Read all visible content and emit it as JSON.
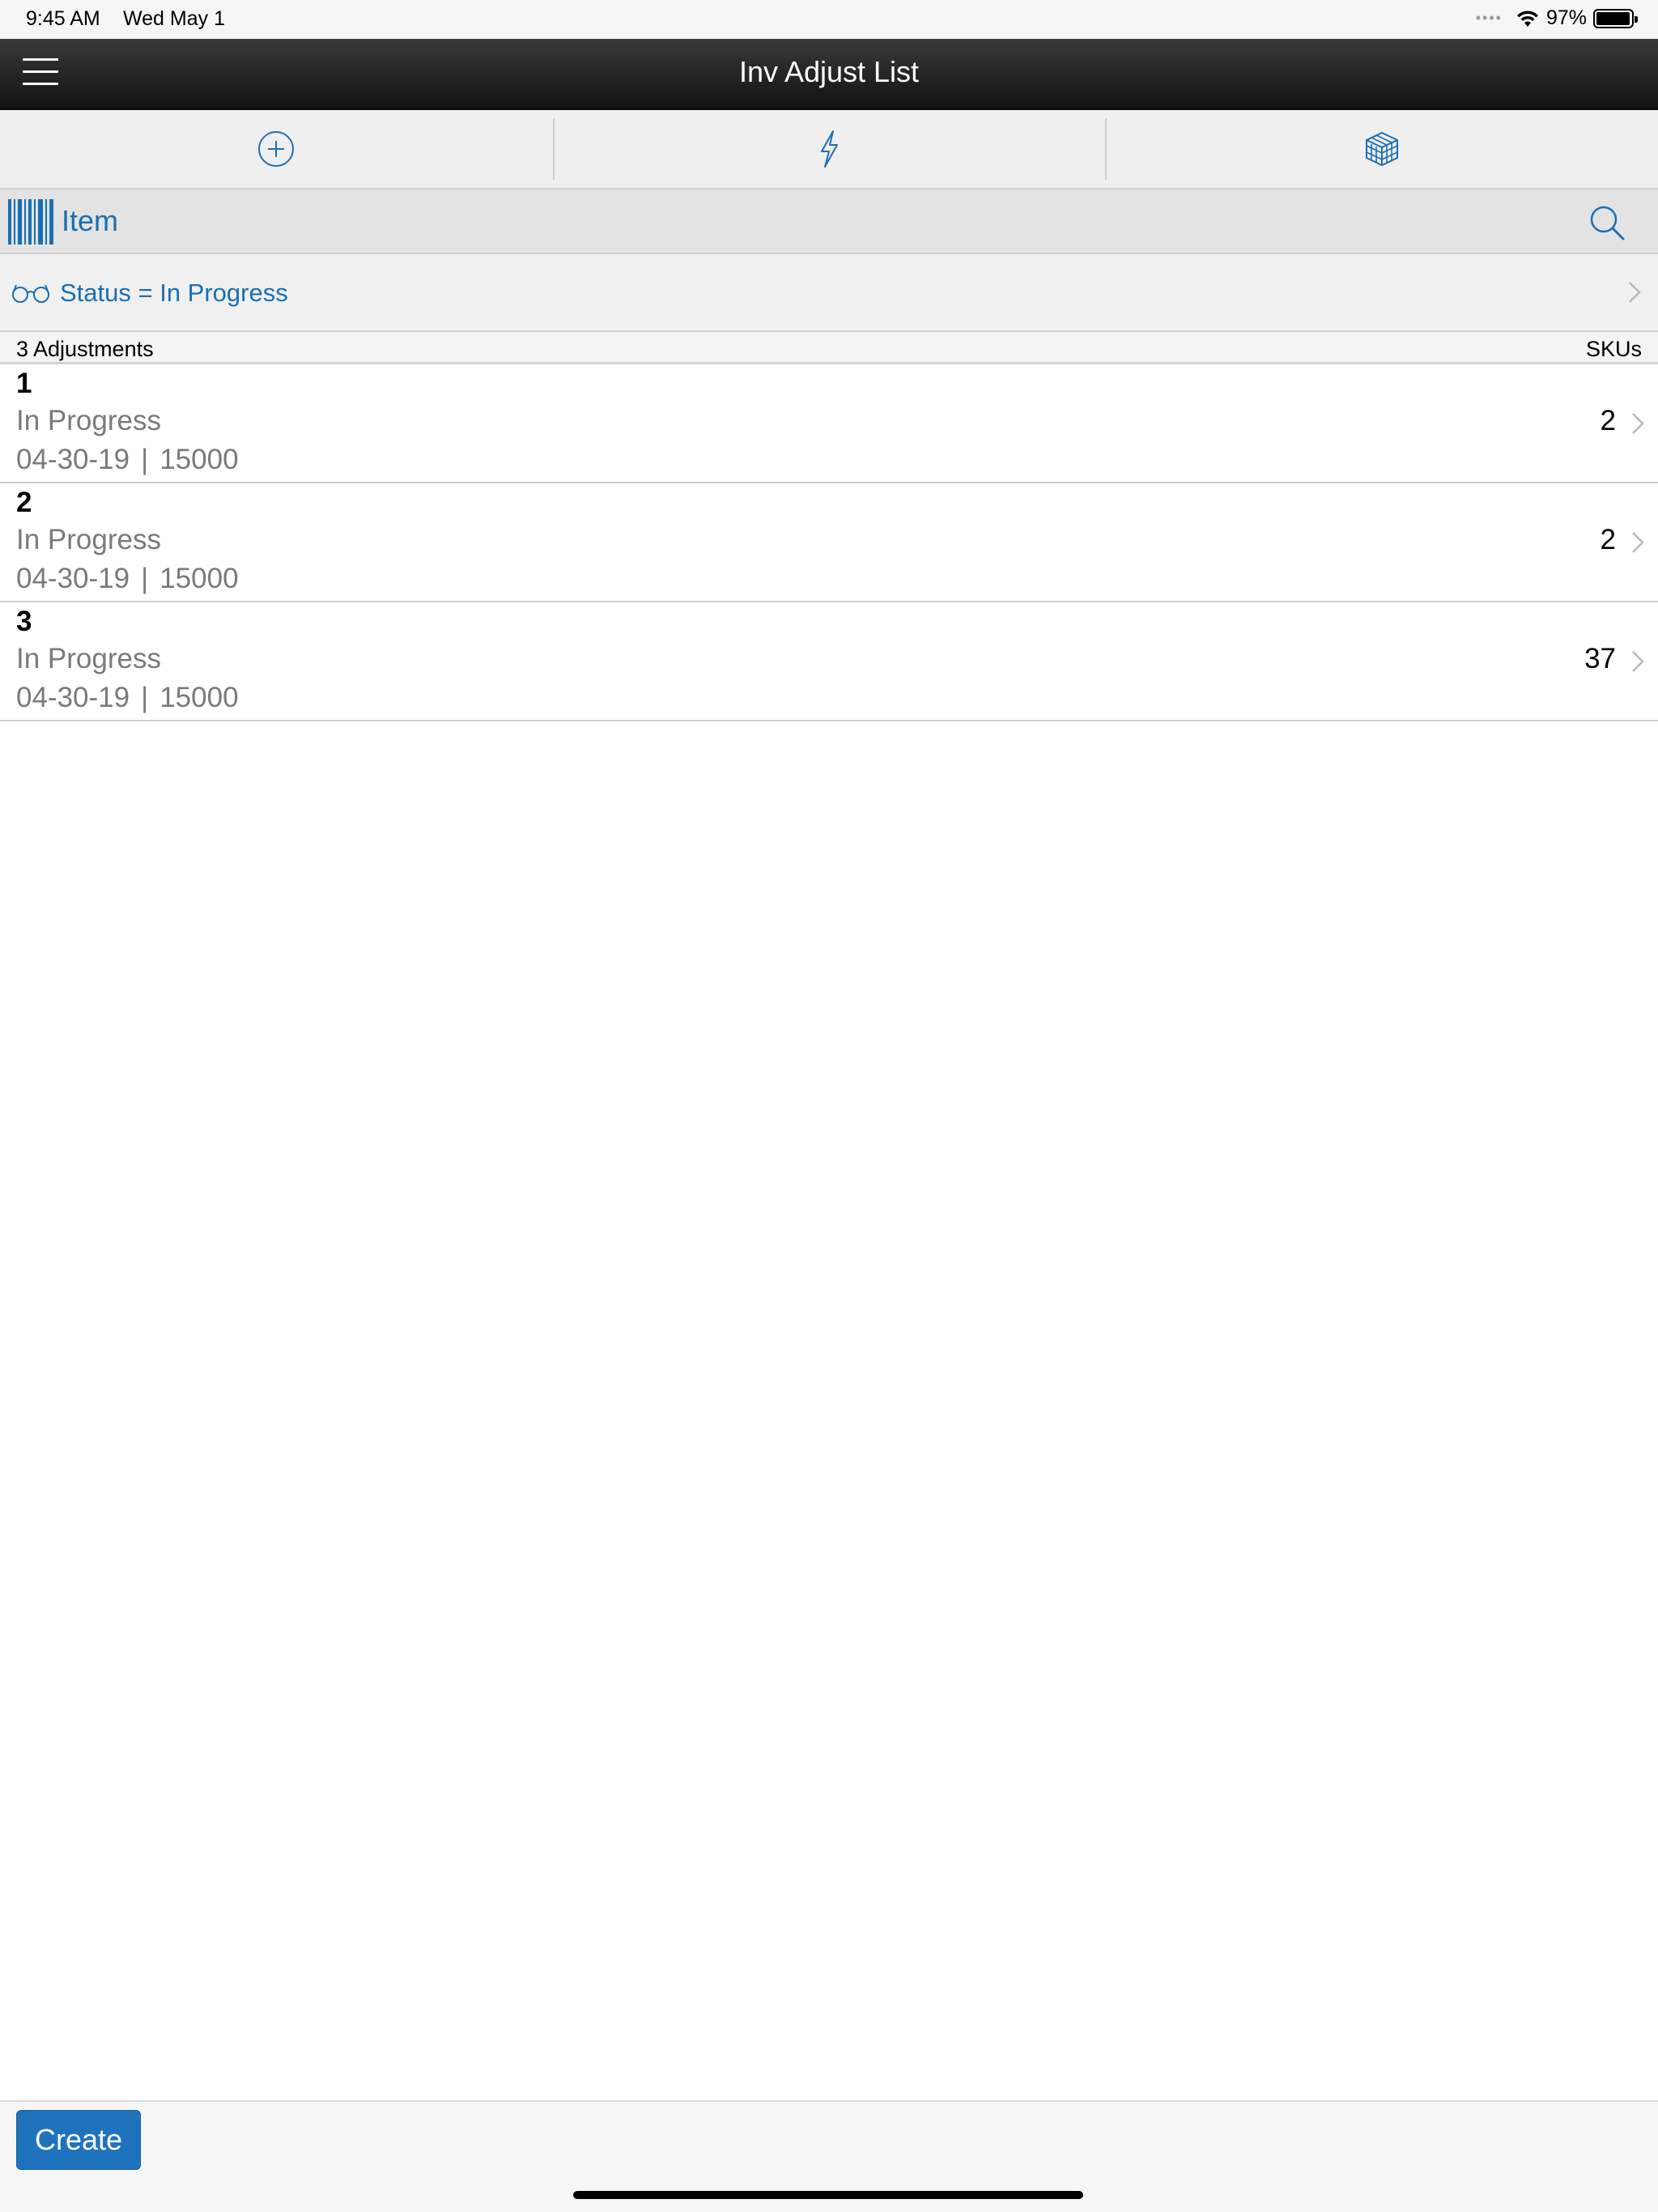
{
  "status_bar": {
    "time": "9:45 AM",
    "date": "Wed May 1",
    "battery_text": "97%",
    "battery_level": 0.97
  },
  "nav": {
    "title": "Inv Adjust List",
    "menu_icon": "hamburger-menu-icon"
  },
  "toolbar": {
    "icons": [
      "plus-circle-icon",
      "lightning-bolt-icon",
      "cube-grid-icon"
    ]
  },
  "scan": {
    "label": "Item",
    "icon": "barcode-icon",
    "search_icon": "search-icon"
  },
  "filter": {
    "label": "Status = In Progress",
    "icon": "glasses-icon"
  },
  "list_header": {
    "count_label": "3 Adjustments",
    "skus_label": "SKUs"
  },
  "rows": [
    {
      "id": "1",
      "status": "In Progress",
      "date": "04-30-19",
      "sep": "|",
      "store": "15000",
      "skus": "2"
    },
    {
      "id": "2",
      "status": "In Progress",
      "date": "04-30-19",
      "sep": "|",
      "store": "15000",
      "skus": "2"
    },
    {
      "id": "3",
      "status": "In Progress",
      "date": "04-30-19",
      "sep": "|",
      "store": "15000",
      "skus": "37"
    }
  ],
  "footer": {
    "create_label": "Create"
  },
  "colors": {
    "accent": "#1a6fb4",
    "button": "#1f73bd",
    "navbar": "#1c1c1c"
  }
}
